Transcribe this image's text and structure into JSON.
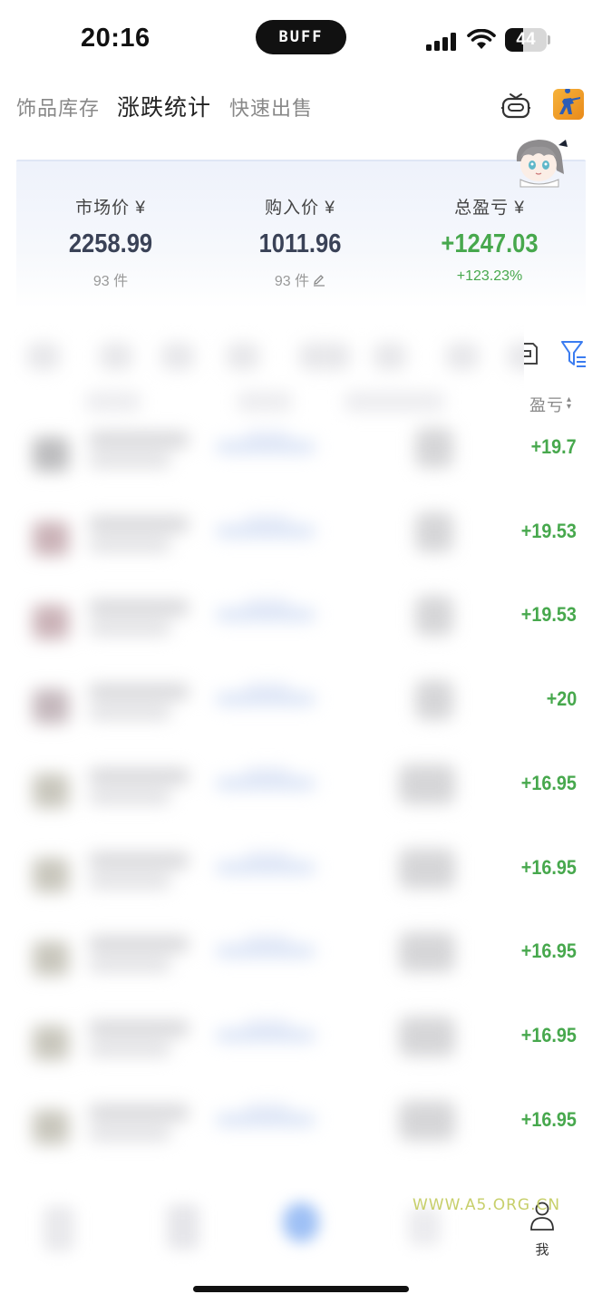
{
  "status_bar": {
    "time": "20:16",
    "island_text": "BUFF",
    "battery": "44",
    "battery_level": 0.44
  },
  "top_tabs": [
    {
      "label": "饰品库存",
      "active": false
    },
    {
      "label": "涨跌统计",
      "active": true
    },
    {
      "label": "快速出售",
      "active": false
    }
  ],
  "header_icons": [
    "robot-icon",
    "game-icon"
  ],
  "summary": {
    "market_price": {
      "label": "市场价 ¥",
      "value": "2258.99",
      "sub": "93 件"
    },
    "purchase_price": {
      "label": "购入价 ¥",
      "value": "1011.96",
      "sub": "93 件"
    },
    "total_profit": {
      "label": "总盈亏 ¥",
      "value": "+1247.03",
      "sub": "+123.23%"
    }
  },
  "list": {
    "sort_header": "盈亏",
    "profits": [
      "+19.7",
      "+19.53",
      "+19.53",
      "+20",
      "+16.95",
      "+16.95",
      "+16.95",
      "+16.95",
      "+16.95"
    ]
  },
  "bottom_nav": {
    "me_label": "我"
  },
  "watermark": "WWW.A5.ORG.CN",
  "colors": {
    "profit_green": "#47a84d",
    "value_dark": "#3a4257",
    "accent_blue": "#3b7cf0"
  }
}
